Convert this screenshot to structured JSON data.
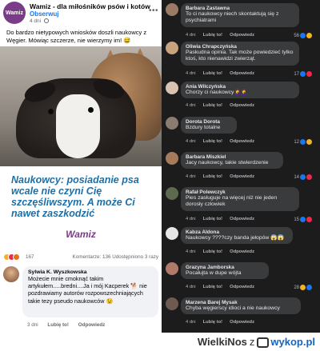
{
  "post": {
    "logo_text": "Wamiz",
    "page_name": "Wamiz - dla miłośników psów i kotów",
    "follow_label": "Obserwuj",
    "time": "4 dni",
    "text": "Do bardzo nietypowych wniosków doszli naukowcy z Węgier. Mówiąc szczerze, nie wierzymy im! 😅",
    "headline": "Naukowcy: posiadanie psa wcale nie czyni Cię szczęśliwszym. A może Ci nawet zaszkodzić",
    "brand": "Wamiz",
    "reaction_count": "167",
    "comments_shares": "Komentarze: 136  Udostępniono 3 razy"
  },
  "post_comment": {
    "name": "Sylwia K. Wyszkowska",
    "text": "Możecie mnie cmoknąć takim artykułem.....bredni....Ja i mój Kacperek 🐕 nie pozdrawiamy autorów rozpowszechniających takie tezy pseudo naukowców 😉",
    "time": "3 dni",
    "like": "Lubię to!",
    "reply": "Odpowiedz"
  },
  "comments": [
    {
      "name": "Barbara Zastawna",
      "text": "To ci naukowcy niech skontaktują się z psychiatrami",
      "time": "4 dni",
      "like": "Lubię to!",
      "reply": "Odpowiedz",
      "count": "56",
      "avatar_color": "#9b7b66"
    },
    {
      "name": "Oliwia Chrapczyńska",
      "text": "Paskudna opinia. Tak może powiedzieć tylko ktoś, kto nienawidzi zwierząt.",
      "time": "4 dni",
      "like": "Lubię to!",
      "reply": "Odpowiedz",
      "count": "17",
      "avatar_color": "#c9a27e"
    },
    {
      "name": "Ania Wilczyńska",
      "text": "Chorzy ci naukowcy🤦‍♀️🤦‍♀️",
      "time": "4 dni",
      "like": "Lubię to!",
      "reply": "Odpowiedz",
      "count": "",
      "avatar_color": "#d8c2b0"
    },
    {
      "name": "Dorota Dorota",
      "text": "Bzdury totalne",
      "time": "4 dni",
      "like": "Lubię to!",
      "reply": "Odpowiedz",
      "count": "12",
      "avatar_color": "#8c7b6f"
    },
    {
      "name": "Barbara Miszkiel",
      "text": "Jacy naukowcy, takie stwierdzenie",
      "time": "4 dni",
      "like": "Lubię to!",
      "reply": "Odpowiedz",
      "count": "14",
      "avatar_color": "#a57b5c"
    },
    {
      "name": "Rafał Polewczyk",
      "text": "Pies zasługuje na więcej niż nie jeden dorosły człowiek",
      "time": "4 dni",
      "like": "Lubię to!",
      "reply": "Odpowiedz",
      "count": "15",
      "avatar_color": "#5d6a4e"
    },
    {
      "name": "Kabza Aldona",
      "text": "Naukowcy ????czy banda jełopów 😱😱",
      "time": "4 dni",
      "like": "Lubię to!",
      "reply": "Odpowiedz",
      "count": "",
      "avatar_color": "#e6e6e6"
    },
    {
      "name": "Grazyna Jamborska",
      "text": "Pocałujta w dupe wójta",
      "time": "4 dni",
      "like": "Lubię to!",
      "reply": "Odpowiedz",
      "count": "28",
      "avatar_color": "#b07a6a"
    },
    {
      "name": "Marzena Barej Mysak",
      "text": "Chyba węgierscy idioci a nie naukowcy",
      "time": "4 dni",
      "like": "Lubię to!",
      "reply": "Odpowiedz",
      "count": "",
      "avatar_color": "#6e5a50"
    }
  ],
  "footer": {
    "author": "WielkiNos",
    "z": "z",
    "site": "wykop.pl"
  },
  "colors": {
    "facebook_blue": "#1877f2",
    "headline_blue": "#1e6fa6",
    "wamiz_purple": "#7a3b87",
    "dark_bg": "#1c1c1d",
    "dark_bubble": "#3a3b3c"
  }
}
